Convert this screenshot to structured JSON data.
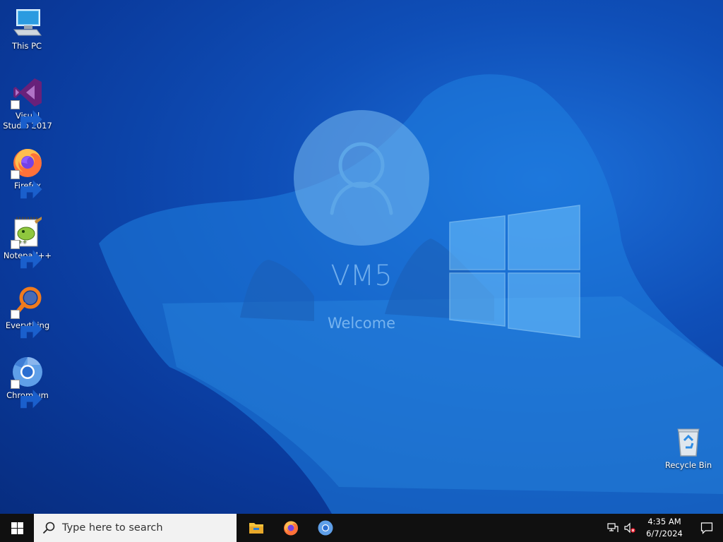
{
  "desktop": {
    "icons": [
      {
        "label": "This PC",
        "icon": "computer-icon"
      },
      {
        "label": "Visual Studio 2017",
        "icon": "visual-studio-icon"
      },
      {
        "label": "Firefox",
        "icon": "firefox-icon"
      },
      {
        "label": "Notepad++",
        "icon": "notepad-plus-plus-icon"
      },
      {
        "label": "Everything",
        "icon": "everything-search-icon"
      },
      {
        "label": "Chromium",
        "icon": "chromium-icon"
      },
      {
        "label": "Recycle Bin",
        "icon": "recycle-bin-icon"
      }
    ]
  },
  "lock_overlay": {
    "username": "VM5",
    "status": "Welcome"
  },
  "taskbar": {
    "search_placeholder": "Type here to search",
    "pinned": [
      {
        "name": "File Explorer",
        "icon": "folder-icon"
      },
      {
        "name": "Firefox",
        "icon": "firefox-icon"
      },
      {
        "name": "Chromium",
        "icon": "chromium-icon"
      }
    ],
    "tray": {
      "network": "network-icon",
      "volume": "volume-muted-icon",
      "time": "4:35 AM",
      "date": "6/7/2024"
    }
  },
  "colors": {
    "wallpaper_dark": "#072d80",
    "wallpaper_light": "#1c6fd8",
    "taskbar": "#101010"
  }
}
